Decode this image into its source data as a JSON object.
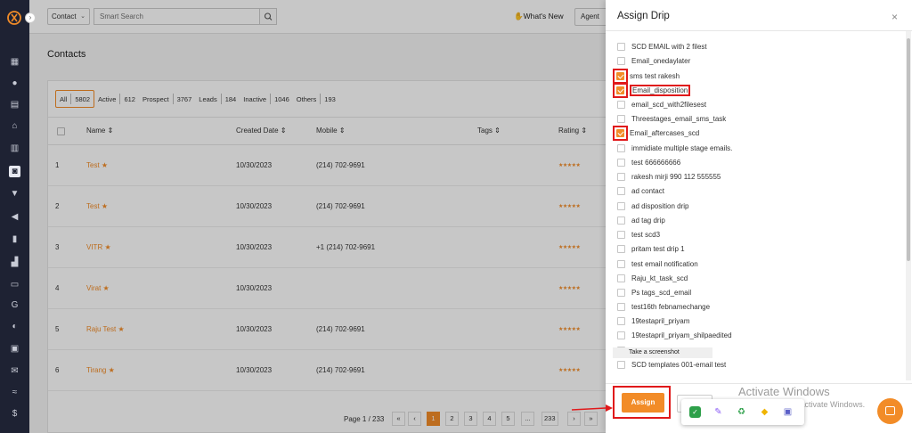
{
  "header": {
    "contact_select": "Contact",
    "search_placeholder": "Smart Search",
    "whats_new": "What's New",
    "agent": "Agent"
  },
  "page_title": "Contacts",
  "filters": [
    {
      "label": "All",
      "count": "5802"
    },
    {
      "label": "Active",
      "count": "612"
    },
    {
      "label": "Prospect",
      "count": "3767"
    },
    {
      "label": "Leads",
      "count": "184"
    },
    {
      "label": "Inactive",
      "count": "1046"
    },
    {
      "label": "Others",
      "count": "193"
    }
  ],
  "table": {
    "headers": {
      "name": "Name",
      "created": "Created Date",
      "mobile": "Mobile",
      "tags": "Tags",
      "rating": "Rating"
    },
    "rows": [
      {
        "num": "1",
        "name": "Test",
        "created": "10/30/2023",
        "mobile": "(214) 702-9691"
      },
      {
        "num": "2",
        "name": "Test",
        "created": "10/30/2023",
        "mobile": "(214) 702-9691"
      },
      {
        "num": "3",
        "name": "VITR",
        "created": "10/30/2023",
        "mobile": "+1 (214) 702-9691"
      },
      {
        "num": "4",
        "name": "Virat",
        "created": "10/30/2023",
        "mobile": ""
      },
      {
        "num": "5",
        "name": "Raju Test",
        "created": "10/30/2023",
        "mobile": "(214) 702-9691"
      },
      {
        "num": "6",
        "name": "Tirang",
        "created": "10/30/2023",
        "mobile": "(214) 702-9691"
      }
    ]
  },
  "pagination": {
    "label": "Page 1 / 233",
    "buttons": [
      "«",
      "‹",
      "1",
      "2",
      "3",
      "4",
      "5",
      "...",
      "233",
      "›",
      "»"
    ],
    "active": "1"
  },
  "modal": {
    "title": "Assign Drip",
    "close": "×",
    "drips": [
      {
        "label": "SCD EMAIL with 2 filest",
        "checked": false,
        "highlight": false
      },
      {
        "label": "Email_onedaylater",
        "checked": false,
        "highlight": false
      },
      {
        "label": "sms test rakesh",
        "checked": true,
        "highlight": true
      },
      {
        "label": "Email_disposition",
        "checked": true,
        "highlight": true
      },
      {
        "label": "email_scd_with2filesest",
        "checked": false,
        "highlight": false
      },
      {
        "label": "Threestages_email_sms_task",
        "checked": false,
        "highlight": false
      },
      {
        "label": "Email_aftercases_scd",
        "checked": true,
        "highlight": true
      },
      {
        "label": "immidiate multiple stage emails.",
        "checked": false,
        "highlight": false
      },
      {
        "label": "test 666666666",
        "checked": false,
        "highlight": false
      },
      {
        "label": "rakesh mirji 990 112 555555",
        "checked": false,
        "highlight": false
      },
      {
        "label": "ad contact",
        "checked": false,
        "highlight": false
      },
      {
        "label": "ad disposition drip",
        "checked": false,
        "highlight": false
      },
      {
        "label": "ad tag drip",
        "checked": false,
        "highlight": false
      },
      {
        "label": "test scd3",
        "checked": false,
        "highlight": false
      },
      {
        "label": "pritam test drip 1",
        "checked": false,
        "highlight": false
      },
      {
        "label": "test email notification",
        "checked": false,
        "highlight": false
      },
      {
        "label": "Raju_kt_task_scd",
        "checked": false,
        "highlight": false
      },
      {
        "label": "Ps tags_scd_email",
        "checked": false,
        "highlight": false
      },
      {
        "label": "test16th febnamechange",
        "checked": false,
        "highlight": false
      },
      {
        "label": "19testapril_priyam",
        "checked": false,
        "highlight": false
      },
      {
        "label": "19testapril_priyam_shilpaedited",
        "checked": false,
        "highlight": false
      },
      {
        "label": "",
        "checked": false,
        "highlight": false
      },
      {
        "label": "SCD templates 001-email test",
        "checked": false,
        "highlight": false
      }
    ],
    "tooltip": "Take a screenshot",
    "assign": "Assign"
  },
  "windows_activation": {
    "title": "Activate Windows",
    "subtitle": "Go to Settings to activate Windows."
  },
  "colors": {
    "accent": "#f28c28",
    "sidebar": "#1e2233",
    "highlight_red": "#e0191b"
  }
}
